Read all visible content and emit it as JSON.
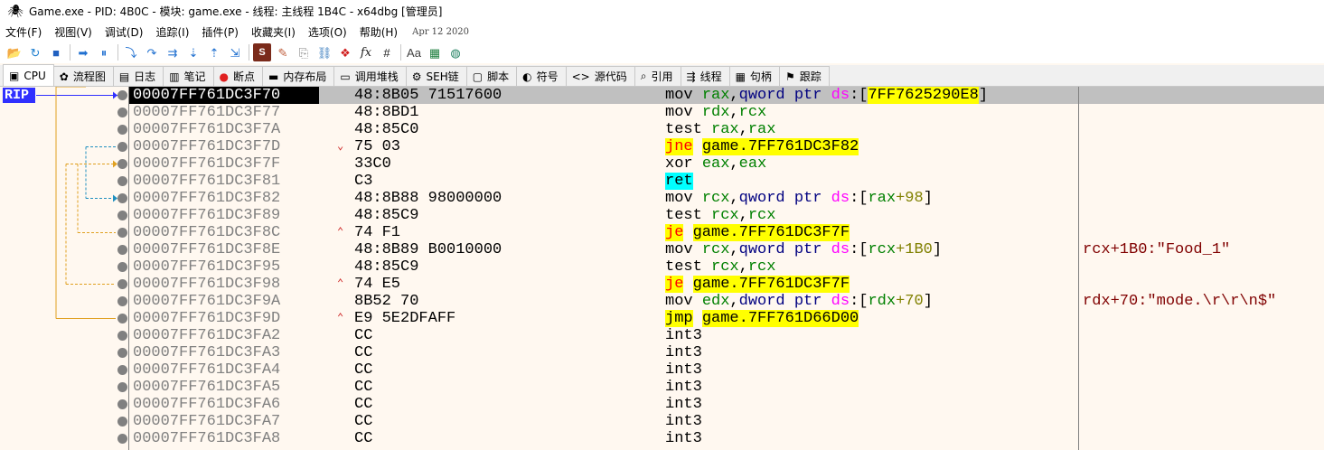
{
  "window": {
    "title": "Game.exe - PID: 4B0C - 模块: game.exe - 线程: 主线程 1B4C - x64dbg [管理员]",
    "app_icon": "bug-icon"
  },
  "menu": {
    "items": [
      "文件(F)",
      "视图(V)",
      "调试(D)",
      "追踪(I)",
      "插件(P)",
      "收藏夹(I)",
      "选项(O)",
      "帮助(H)"
    ],
    "date": "Apr 12 2020"
  },
  "toolbar": {
    "buttons": [
      {
        "name": "open-icon",
        "glyph": "📂"
      },
      {
        "name": "restart-icon",
        "glyph": "↻"
      },
      {
        "name": "stop-icon",
        "glyph": "■"
      },
      {
        "name": "run-icon",
        "glyph": "➡"
      },
      {
        "name": "pause-icon",
        "glyph": "⏸"
      },
      {
        "name": "step-into-icon",
        "glyph": "⤵"
      },
      {
        "name": "step-over-icon",
        "glyph": "↷"
      },
      {
        "name": "trace-into-icon",
        "glyph": "⇉"
      },
      {
        "name": "trace-over-icon",
        "glyph": "⇣"
      },
      {
        "name": "execute-till-return-icon",
        "glyph": "⇡"
      },
      {
        "name": "run-to-user-code-icon",
        "glyph": "⇲"
      },
      {
        "name": "scylla-icon",
        "glyph": "S"
      },
      {
        "name": "patch-icon",
        "glyph": "✎"
      },
      {
        "name": "comments-icon",
        "glyph": "⎘"
      },
      {
        "name": "labels-icon",
        "glyph": "⛓"
      },
      {
        "name": "bookmarks-icon",
        "glyph": "❖"
      },
      {
        "name": "function-icon",
        "glyph": "fx"
      },
      {
        "name": "hash-icon",
        "glyph": "#"
      },
      {
        "name": "font-icon",
        "glyph": "Aa"
      },
      {
        "name": "calculator-icon",
        "glyph": "▦"
      },
      {
        "name": "globe-icon",
        "glyph": "◍"
      }
    ]
  },
  "tabs": [
    {
      "label": "CPU",
      "icon": "cpu-icon",
      "glyph": "▣",
      "active": true
    },
    {
      "label": "流程图",
      "icon": "graph-icon",
      "glyph": "✿"
    },
    {
      "label": "日志",
      "icon": "log-icon",
      "glyph": "▤"
    },
    {
      "label": "笔记",
      "icon": "notes-icon",
      "glyph": "▥"
    },
    {
      "label": "断点",
      "icon": "breakpoint-icon",
      "glyph": "●"
    },
    {
      "label": "内存布局",
      "icon": "memory-icon",
      "glyph": "▬"
    },
    {
      "label": "调用堆栈",
      "icon": "callstack-icon",
      "glyph": "▭"
    },
    {
      "label": "SEH链",
      "icon": "seh-icon",
      "glyph": "⚙"
    },
    {
      "label": "脚本",
      "icon": "script-icon",
      "glyph": "▢"
    },
    {
      "label": "符号",
      "icon": "symbols-icon",
      "glyph": "◐"
    },
    {
      "label": "源代码",
      "icon": "source-icon",
      "glyph": "<>"
    },
    {
      "label": "引用",
      "icon": "references-icon",
      "glyph": "⌕"
    },
    {
      "label": "线程",
      "icon": "threads-icon",
      "glyph": "⇶"
    },
    {
      "label": "句柄",
      "icon": "handles-icon",
      "glyph": "▦"
    },
    {
      "label": "跟踪",
      "icon": "trace-icon",
      "glyph": "⚑"
    }
  ],
  "rip_label": "RIP",
  "colors": {
    "selected_row": "#c0c0c0",
    "jump_highlight": "#ffff00",
    "ret_highlight": "#00ffff",
    "conditional_jump_text": "#ff0000",
    "rip_badge": "#3030ff"
  },
  "disasm": {
    "rows": [
      {
        "addr": "00007FF761DC3F70",
        "bytes": "48:8B05 71517600",
        "mark": "",
        "instr_parts": [
          [
            "mov ",
            ""
          ],
          [
            "rax",
            "kw-green"
          ],
          [
            ",",
            ""
          ],
          [
            "qword ptr ",
            "kw-blue"
          ],
          [
            "ds",
            "kw-ds"
          ],
          [
            ":[",
            ""
          ],
          [
            "7FF7625290E8",
            "hl-yellow"
          ],
          [
            "]",
            ""
          ]
        ],
        "comment": "",
        "selected": true
      },
      {
        "addr": "00007FF761DC3F77",
        "bytes": "48:8BD1",
        "mark": "",
        "instr_parts": [
          [
            "mov ",
            ""
          ],
          [
            "rdx",
            "kw-green"
          ],
          [
            ",",
            ""
          ],
          [
            "rcx",
            "kw-green"
          ]
        ],
        "comment": ""
      },
      {
        "addr": "00007FF761DC3F7A",
        "bytes": "48:85C0",
        "mark": "",
        "instr_parts": [
          [
            "test ",
            ""
          ],
          [
            "rax",
            "kw-green"
          ],
          [
            ",",
            ""
          ],
          [
            "rax",
            "kw-green"
          ]
        ],
        "comment": ""
      },
      {
        "addr": "00007FF761DC3F7D",
        "bytes": "75 03",
        "mark": "⌄",
        "instr_parts": [
          [
            "jne",
            "mn-cj"
          ],
          [
            " ",
            ""
          ],
          [
            "game.7FF761DC3F82",
            "mn-jmp"
          ]
        ],
        "comment": ""
      },
      {
        "addr": "00007FF761DC3F7F",
        "bytes": "33C0",
        "mark": "",
        "instr_parts": [
          [
            "xor ",
            ""
          ],
          [
            "eax",
            "kw-green"
          ],
          [
            ",",
            ""
          ],
          [
            "eax",
            "kw-green"
          ]
        ],
        "comment": ""
      },
      {
        "addr": "00007FF761DC3F81",
        "bytes": "C3",
        "mark": "",
        "instr_parts": [
          [
            "ret",
            "mn-ret"
          ]
        ],
        "comment": ""
      },
      {
        "addr": "00007FF761DC3F82",
        "bytes": "48:8B88 98000000",
        "mark": "",
        "instr_parts": [
          [
            "mov ",
            ""
          ],
          [
            "rcx",
            "kw-green"
          ],
          [
            ",",
            ""
          ],
          [
            "qword ptr ",
            "kw-blue"
          ],
          [
            "ds",
            "kw-ds"
          ],
          [
            ":[",
            ""
          ],
          [
            "rax",
            "kw-green"
          ],
          [
            "+98",
            "num"
          ],
          [
            "]",
            ""
          ]
        ],
        "comment": ""
      },
      {
        "addr": "00007FF761DC3F89",
        "bytes": "48:85C9",
        "mark": "",
        "instr_parts": [
          [
            "test ",
            ""
          ],
          [
            "rcx",
            "kw-green"
          ],
          [
            ",",
            ""
          ],
          [
            "rcx",
            "kw-green"
          ]
        ],
        "comment": ""
      },
      {
        "addr": "00007FF761DC3F8C",
        "bytes": "74 F1",
        "mark": "⌃",
        "instr_parts": [
          [
            "je",
            "mn-cj"
          ],
          [
            " ",
            ""
          ],
          [
            "game.7FF761DC3F7F",
            "mn-jmp"
          ]
        ],
        "comment": ""
      },
      {
        "addr": "00007FF761DC3F8E",
        "bytes": "48:8B89 B0010000",
        "mark": "",
        "instr_parts": [
          [
            "mov ",
            ""
          ],
          [
            "rcx",
            "kw-green"
          ],
          [
            ",",
            ""
          ],
          [
            "qword ptr ",
            "kw-blue"
          ],
          [
            "ds",
            "kw-ds"
          ],
          [
            ":[",
            ""
          ],
          [
            "rcx",
            "kw-green"
          ],
          [
            "+1B0",
            "num"
          ],
          [
            "]",
            ""
          ]
        ],
        "comment": "rcx+1B0:\"Food_1\""
      },
      {
        "addr": "00007FF761DC3F95",
        "bytes": "48:85C9",
        "mark": "",
        "instr_parts": [
          [
            "test ",
            ""
          ],
          [
            "rcx",
            "kw-green"
          ],
          [
            ",",
            ""
          ],
          [
            "rcx",
            "kw-green"
          ]
        ],
        "comment": ""
      },
      {
        "addr": "00007FF761DC3F98",
        "bytes": "74 E5",
        "mark": "⌃",
        "instr_parts": [
          [
            "je",
            "mn-cj"
          ],
          [
            " ",
            ""
          ],
          [
            "game.7FF761DC3F7F",
            "mn-jmp"
          ]
        ],
        "comment": ""
      },
      {
        "addr": "00007FF761DC3F9A",
        "bytes": "8B52 70",
        "mark": "",
        "instr_parts": [
          [
            "mov ",
            ""
          ],
          [
            "edx",
            "kw-green"
          ],
          [
            ",",
            ""
          ],
          [
            "dword ptr ",
            "kw-blue"
          ],
          [
            "ds",
            "kw-ds"
          ],
          [
            ":[",
            ""
          ],
          [
            "rdx",
            "kw-green"
          ],
          [
            "+70",
            "num"
          ],
          [
            "]",
            ""
          ]
        ],
        "comment": "rdx+70:\"mode.\\r\\r\\n$\""
      },
      {
        "addr": "00007FF761DC3F9D",
        "bytes": "E9 5E2DFAFF",
        "mark": "⌃",
        "instr_parts": [
          [
            "jmp",
            "mn-jmp"
          ],
          [
            " ",
            ""
          ],
          [
            "game.7FF761D66D00",
            "mn-jmp"
          ]
        ],
        "comment": ""
      },
      {
        "addr": "00007FF761DC3FA2",
        "bytes": "CC",
        "mark": "",
        "instr_parts": [
          [
            "int3",
            ""
          ]
        ],
        "comment": ""
      },
      {
        "addr": "00007FF761DC3FA3",
        "bytes": "CC",
        "mark": "",
        "instr_parts": [
          [
            "int3",
            ""
          ]
        ],
        "comment": ""
      },
      {
        "addr": "00007FF761DC3FA4",
        "bytes": "CC",
        "mark": "",
        "instr_parts": [
          [
            "int3",
            ""
          ]
        ],
        "comment": ""
      },
      {
        "addr": "00007FF761DC3FA5",
        "bytes": "CC",
        "mark": "",
        "instr_parts": [
          [
            "int3",
            ""
          ]
        ],
        "comment": ""
      },
      {
        "addr": "00007FF761DC3FA6",
        "bytes": "CC",
        "mark": "",
        "instr_parts": [
          [
            "int3",
            ""
          ]
        ],
        "comment": ""
      },
      {
        "addr": "00007FF761DC3FA7",
        "bytes": "CC",
        "mark": "",
        "instr_parts": [
          [
            "int3",
            ""
          ]
        ],
        "comment": ""
      },
      {
        "addr": "00007FF761DC3FA8",
        "bytes": "CC",
        "mark": "",
        "instr_parts": [
          [
            "int3",
            ""
          ]
        ],
        "comment": ""
      }
    ]
  }
}
